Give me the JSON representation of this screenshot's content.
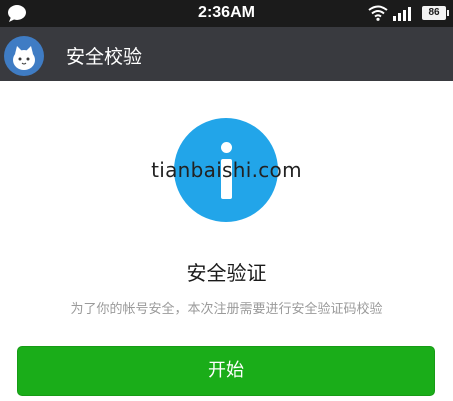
{
  "status_bar": {
    "time": "2:36AM",
    "battery": "86",
    "icons": [
      "chat-bubble-icon",
      "wifi-icon",
      "signal-icon",
      "battery-icon"
    ]
  },
  "app_bar": {
    "title": "安全校验",
    "logo_icon": "app-logo-icon"
  },
  "main": {
    "icon": "info-icon",
    "watermark": "tianbaishi.com",
    "title": "安全验证",
    "description": "为了你的帐号安全，本次注册需要进行安全验证码校验",
    "start_button_label": "开始"
  },
  "colors": {
    "status_bar_bg": "#1b1b1b",
    "app_bar_bg": "#393a3f",
    "info_icon": "#22a5e9",
    "button_green": "#1aad19"
  }
}
